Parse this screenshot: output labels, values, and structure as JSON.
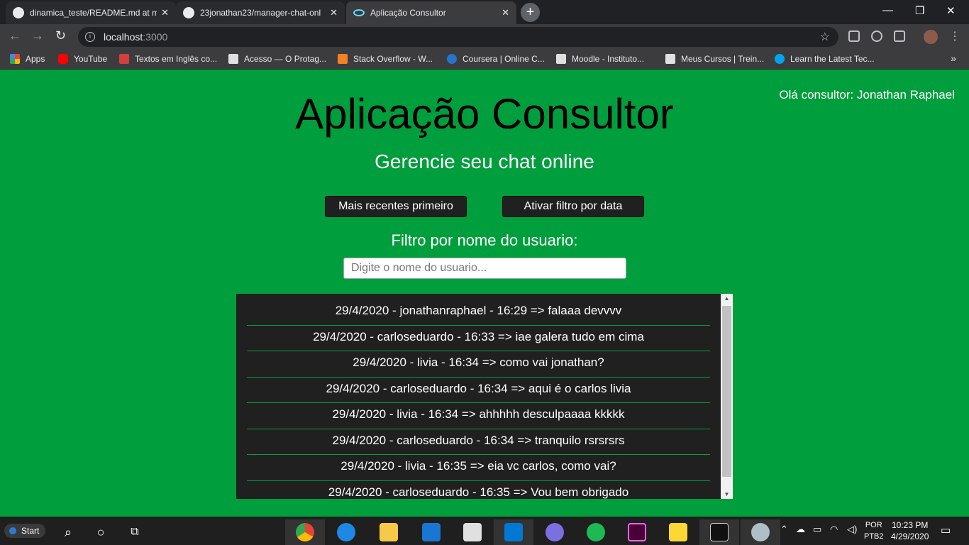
{
  "browser": {
    "tabs": [
      {
        "title": "dinamica_teste/README.md at m",
        "close": "✕"
      },
      {
        "title": "23jonathan23/manager-chat-onl",
        "close": "✕"
      },
      {
        "title": "Aplicação Consultor",
        "close": "✕"
      }
    ],
    "new_tab": "+",
    "url_host": "localhost",
    "url_port": ":3000",
    "bookmarks": [
      {
        "label": "Apps",
        "color": "#ea4335"
      },
      {
        "label": "YouTube",
        "color": "#ff0000"
      },
      {
        "label": "Textos em Inglês co...",
        "color": "#d23f3f"
      },
      {
        "label": "Acesso — O Protag...",
        "color": "#e0e0e0"
      },
      {
        "label": "Stack Overflow - W...",
        "color": "#f48024"
      },
      {
        "label": "Coursera | Online C...",
        "color": "#2a73cc"
      },
      {
        "label": "Moodle - Instituto...",
        "color": "#e0e0e0"
      },
      {
        "label": "Meus Cursos | Trein...",
        "color": "#e0e0e0"
      },
      {
        "label": "Learn the Latest Tec...",
        "color": "#00a4ef"
      }
    ],
    "bookmarks_more": "»"
  },
  "page": {
    "greeting": "Olá consultor: Jonathan Raphael",
    "title": "Aplicação Consultor",
    "subtitle": "Gerencie seu chat online",
    "sort_button": "Mais recentes primeiro",
    "date_filter_button": "Ativar filtro por data",
    "filter_label": "Filtro por nome do usuario:",
    "filter_placeholder": "Digite o nome do usuario...",
    "messages": [
      "29/4/2020 - jonathanraphael - 16:29 => falaaa devvvv",
      "29/4/2020 - carloseduardo - 16:33 => iae galera tudo em cima",
      "29/4/2020 - livia - 16:34 => como vai jonathan?",
      "29/4/2020 - carloseduardo - 16:34 => aqui é o carlos livia",
      "29/4/2020 - livia - 16:34 => ahhhhh desculpaaaa kkkkk",
      "29/4/2020 - carloseduardo - 16:34 => tranquilo rsrsrsrs",
      "29/4/2020 - livia - 16:35 => eia vc carlos, como vai?",
      "29/4/2020 - carloseduardo - 16:35 => Vou bem obrigado"
    ]
  },
  "taskbar": {
    "start": "Start",
    "lang_top": "POR",
    "lang_bottom": "PTB2",
    "time": "10:23 PM",
    "date": "4/29/2020"
  },
  "colors": {
    "page_bg": "#009e3c",
    "chat_bg": "#202020",
    "button_bg": "#202020",
    "divider": "#00a043"
  }
}
